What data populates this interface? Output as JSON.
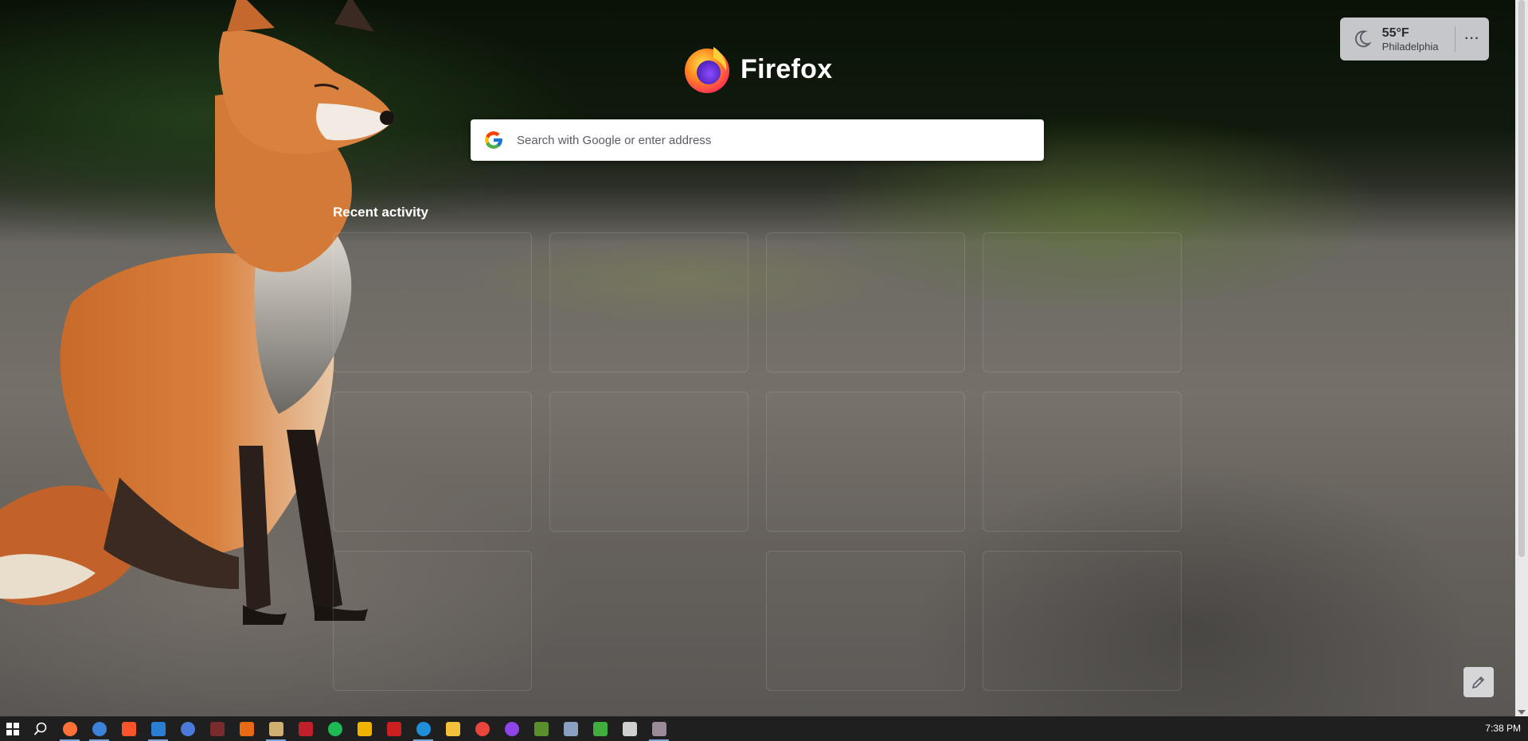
{
  "brand": {
    "name": "Firefox"
  },
  "search": {
    "placeholder": "Search with Google or enter address"
  },
  "weather": {
    "temperature": "55°F",
    "city": "Philadelphia",
    "menu_label": "···"
  },
  "recent": {
    "title": "Recent activity",
    "cards": 11
  },
  "taskbar": {
    "clock": "7:38 PM",
    "apps": [
      {
        "name": "firefox",
        "color": "#ff7139",
        "running": true
      },
      {
        "name": "thunderbird",
        "color": "#3b82d8",
        "running": true
      },
      {
        "name": "brave",
        "color": "#fb542b",
        "running": false
      },
      {
        "name": "app-blue-star",
        "color": "#2b7fd3",
        "running": true
      },
      {
        "name": "app-blue-circle",
        "color": "#4d7ad8",
        "running": false
      },
      {
        "name": "app-dark-figure",
        "color": "#7a2c2c",
        "running": false
      },
      {
        "name": "app-orange-b",
        "color": "#e86a17",
        "running": false
      },
      {
        "name": "app-active-window",
        "color": "#d0b070",
        "running": true
      },
      {
        "name": "app-red-rect",
        "color": "#c0202a",
        "running": false
      },
      {
        "name": "spotify",
        "color": "#1db954",
        "running": false
      },
      {
        "name": "app-yellow-cross",
        "color": "#f0b400",
        "running": false
      },
      {
        "name": "app-red-doc",
        "color": "#cc1f1f",
        "running": false
      },
      {
        "name": "edge",
        "color": "#1e8fd8",
        "running": true
      },
      {
        "name": "file-explorer",
        "color": "#f3c13a",
        "running": false
      },
      {
        "name": "chrome",
        "color": "#e8453c",
        "running": false
      },
      {
        "name": "app-purple-circle",
        "color": "#8e44e8",
        "running": false
      },
      {
        "name": "app-green-gear",
        "color": "#5a8f2e",
        "running": false
      },
      {
        "name": "app-remote-desktop",
        "color": "#8aa0c0",
        "running": false
      },
      {
        "name": "app-green-lock",
        "color": "#3fae3f",
        "running": false
      },
      {
        "name": "settings",
        "color": "#cfcfcf",
        "running": false
      },
      {
        "name": "app-gray-window",
        "color": "#9a8a9a",
        "running": true
      }
    ]
  }
}
